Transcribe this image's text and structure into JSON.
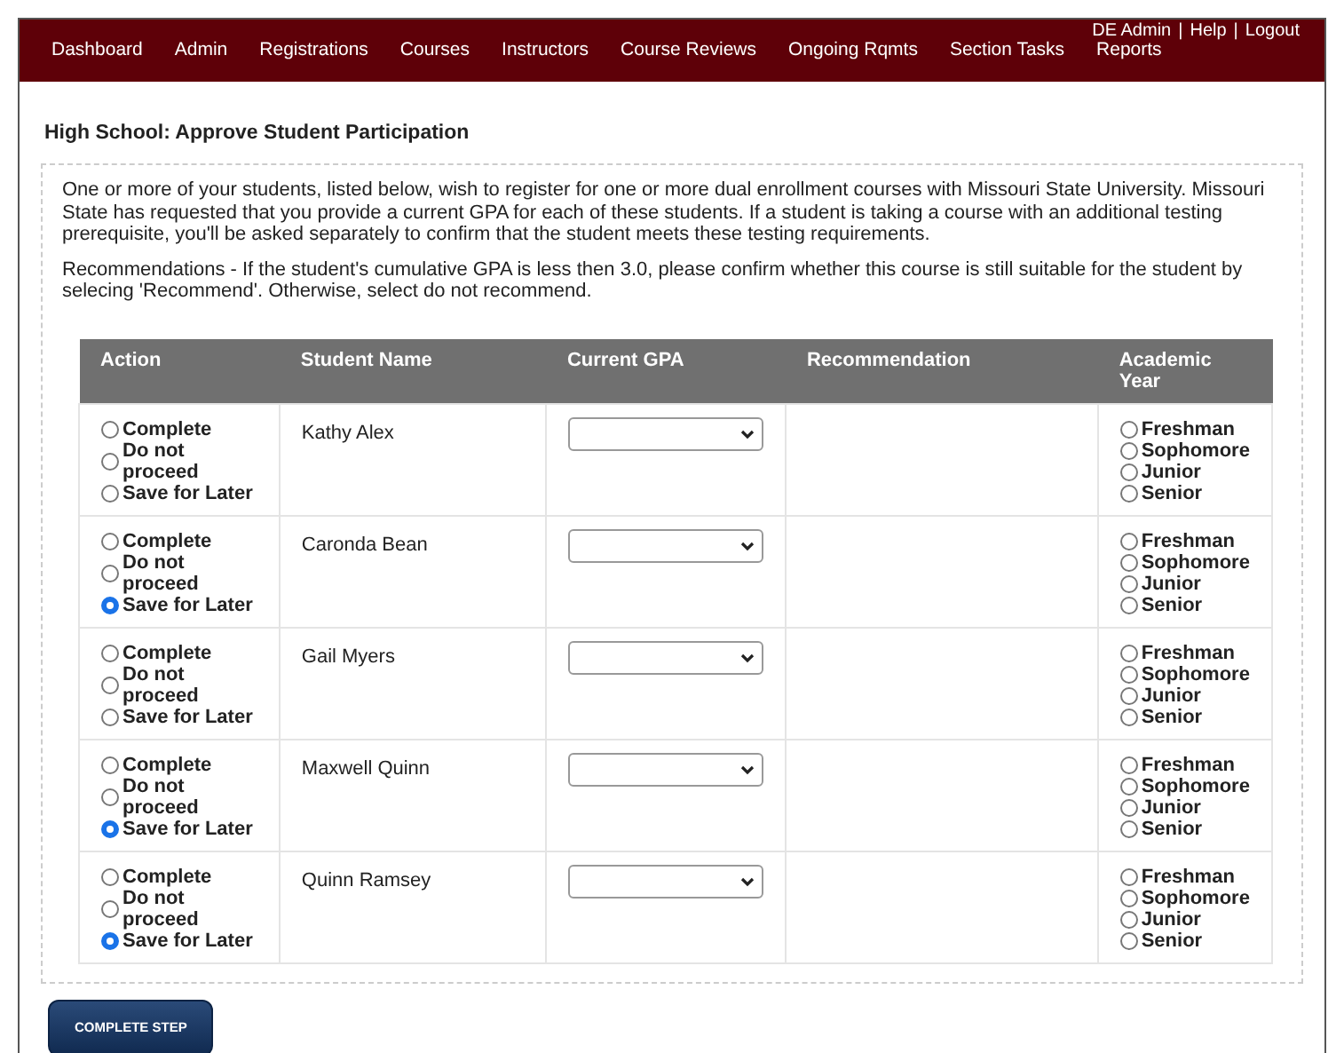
{
  "user_links": [
    "DE Admin",
    "|",
    "Help",
    "|",
    "Logout"
  ],
  "nav": [
    "Dashboard",
    "Admin",
    "Registrations",
    "Courses",
    "Instructors",
    "Course Reviews",
    "Ongoing Rqmts",
    "Section Tasks",
    "Reports"
  ],
  "page_title": "High School: Approve Student Participation",
  "intro": [
    "One or more of your students, listed below, wish to register for one or more dual enrollment courses with Missouri State University. Missouri State has requested that you provide a current GPA for each of these students. If a student is taking a course with an additional testing prerequisite, you'll be asked separately to confirm that the student meets these testing requirements.",
    "Recommendations - If the student's cumulative GPA is less then 3.0, please confirm whether this course is still suitable for the student by selecing 'Recommend'. Otherwise, select do not recommend."
  ],
  "table": {
    "columns": [
      "Action",
      "Student Name",
      "Current GPA",
      "Recommendation",
      "Academic Year"
    ],
    "rows": [
      {
        "actions": [
          {
            "label": "Complete",
            "selected": false
          },
          {
            "label": "Do not proceed",
            "selected": false
          },
          {
            "label": "Save for Later",
            "selected": false
          }
        ],
        "student": "Kathy Alex",
        "years": [
          {
            "label": "Freshman",
            "selected": false
          },
          {
            "label": "Sophomore",
            "selected": false
          },
          {
            "label": "Junior",
            "selected": false
          },
          {
            "label": "Senior",
            "selected": false
          }
        ]
      },
      {
        "actions": [
          {
            "label": "Complete",
            "selected": false
          },
          {
            "label": "Do not proceed",
            "selected": false
          },
          {
            "label": "Save for Later",
            "selected": true
          }
        ],
        "student": "Caronda Bean",
        "years": [
          {
            "label": "Freshman",
            "selected": false
          },
          {
            "label": "Sophomore",
            "selected": false
          },
          {
            "label": "Junior",
            "selected": false
          },
          {
            "label": "Senior",
            "selected": false
          }
        ]
      },
      {
        "actions": [
          {
            "label": "Complete",
            "selected": false
          },
          {
            "label": "Do not proceed",
            "selected": false
          },
          {
            "label": "Save for Later",
            "selected": false
          }
        ],
        "student": "Gail Myers",
        "years": [
          {
            "label": "Freshman",
            "selected": false
          },
          {
            "label": "Sophomore",
            "selected": false
          },
          {
            "label": "Junior",
            "selected": false
          },
          {
            "label": "Senior",
            "selected": false
          }
        ]
      },
      {
        "actions": [
          {
            "label": "Complete",
            "selected": false
          },
          {
            "label": "Do not proceed",
            "selected": false
          },
          {
            "label": "Save for Later",
            "selected": true
          }
        ],
        "student": "Maxwell Quinn",
        "years": [
          {
            "label": "Freshman",
            "selected": false
          },
          {
            "label": "Sophomore",
            "selected": false
          },
          {
            "label": "Junior",
            "selected": false
          },
          {
            "label": "Senior",
            "selected": false
          }
        ]
      },
      {
        "actions": [
          {
            "label": "Complete",
            "selected": false
          },
          {
            "label": "Do not proceed",
            "selected": false
          },
          {
            "label": "Save for Later",
            "selected": true
          }
        ],
        "student": "Quinn Ramsey",
        "years": [
          {
            "label": "Freshman",
            "selected": false
          },
          {
            "label": "Sophomore",
            "selected": false
          },
          {
            "label": "Junior",
            "selected": false
          },
          {
            "label": "Senior",
            "selected": false
          }
        ]
      }
    ]
  },
  "button": "COMPLETE STEP"
}
